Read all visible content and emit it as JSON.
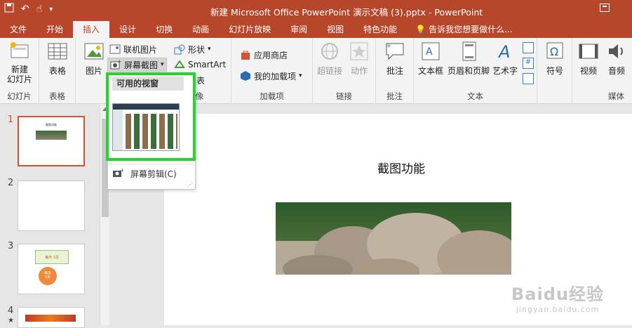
{
  "window": {
    "title": "新建 Microsoft Office PowerPoint 演示文稿 (3).pptx - PowerPoint"
  },
  "quick_access": {
    "icons": [
      "save-icon",
      "undo-icon",
      "touch-mode-icon",
      "customize-icon"
    ]
  },
  "tabs": [
    {
      "label": "文件"
    },
    {
      "label": "开始"
    },
    {
      "label": "插入"
    },
    {
      "label": "设计"
    },
    {
      "label": "切换"
    },
    {
      "label": "动画"
    },
    {
      "label": "幻灯片放映"
    },
    {
      "label": "审阅"
    },
    {
      "label": "视图"
    },
    {
      "label": "特色功能"
    }
  ],
  "active_tab": "插入",
  "tell_me": {
    "placeholder": "告诉我您想要做什么..."
  },
  "ribbon": {
    "new_slide": "新建\n幻灯片",
    "table": "表格",
    "picture": "图片",
    "online_picture": "联机图片",
    "screenshot": "屏幕截图",
    "shapes": "形状",
    "smartart": "SmartArt",
    "chart": "图表",
    "store": "应用商店",
    "my_addins": "我的加载项",
    "hyperlink": "超链接",
    "action": "动作",
    "comment": "批注",
    "textbox": "文本框",
    "header_footer": "页眉和页脚",
    "wordart": "艺术字",
    "symbol": "符号",
    "video": "视频",
    "audio": "音频",
    "group_labels": {
      "slides": "幻灯片",
      "tables": "表格",
      "images": "图像",
      "addins": "加载项",
      "links": "链接",
      "comments": "批注",
      "text": "文本",
      "media": "媒体"
    }
  },
  "dropdown": {
    "header": "可用的视窗",
    "clipping": "屏幕剪辑(C)"
  },
  "slides": [
    {
      "number": "1",
      "label": "截图功能"
    },
    {
      "number": "2"
    },
    {
      "number": "3",
      "lines": [
        "每天",
        "1页",
        "每天",
        "1页",
        "1页"
      ]
    },
    {
      "number": "4"
    }
  ],
  "slide": {
    "title": "截图功能"
  },
  "watermark": {
    "text": "Baidu经验",
    "sub": "jingyan.baidu.com"
  },
  "colors": {
    "accent": "#b7472a",
    "selection": "#d35230",
    "highlight": "#22d62a"
  }
}
